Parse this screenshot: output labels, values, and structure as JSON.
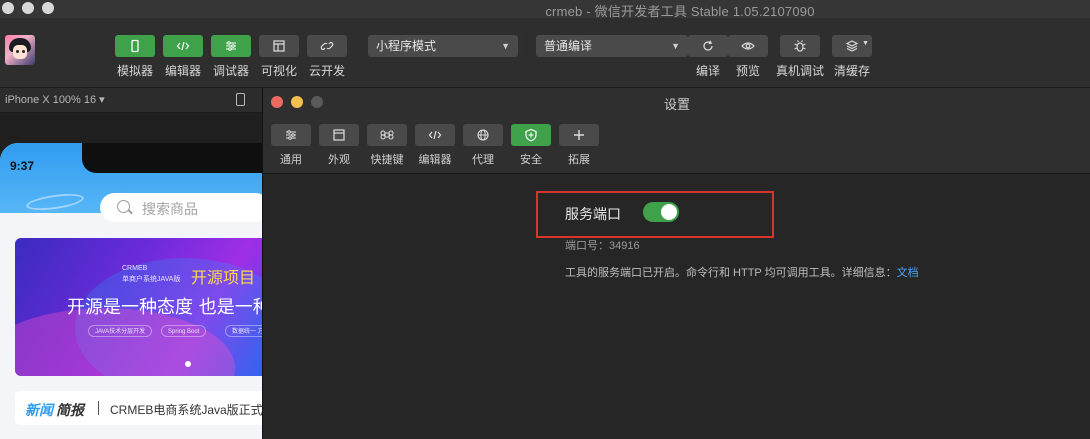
{
  "window": {
    "title": "crmeb - 微信开发者工具 Stable 1.05.2107090"
  },
  "toolbar": {
    "left_buttons": [
      {
        "label": "模拟器",
        "icon": "phone-icon"
      },
      {
        "label": "编辑器",
        "icon": "code-icon"
      },
      {
        "label": "调试器",
        "icon": "sliders-icon"
      },
      {
        "label": "可视化",
        "icon": "layout-icon"
      },
      {
        "label": "云开发",
        "icon": "cloud-link-icon"
      }
    ],
    "mode_select": "小程序模式",
    "compile_select": "普通编译",
    "right_buttons": [
      {
        "label": "编译",
        "icon": "refresh-icon"
      },
      {
        "label": "预览",
        "icon": "eye-icon"
      },
      {
        "label": "真机调试",
        "icon": "bug-icon"
      },
      {
        "label": "清缓存",
        "icon": "layers-icon"
      }
    ]
  },
  "simulator": {
    "device": "iPhone X 100% 16 ▾",
    "time": "9:37",
    "search_placeholder": "搜索商品",
    "banner": {
      "small1": "CRMEB",
      "small2": "单商户系统JAVA版",
      "tag": "开源项目",
      "headline": "开源是一种态度 也是一种",
      "pills": [
        "JAVA技术分层开发",
        "Spring Boot",
        "数据统一 方"
      ]
    },
    "news": {
      "label_a": "新闻",
      "label_b": "简报",
      "text": "CRMEB电商系统Java版正式发布"
    }
  },
  "settings": {
    "title": "设置",
    "tabs": [
      {
        "label": "通用",
        "icon": "sliders-icon"
      },
      {
        "label": "外观",
        "icon": "window-icon"
      },
      {
        "label": "快捷键",
        "icon": "command-icon"
      },
      {
        "label": "编辑器",
        "icon": "code-icon"
      },
      {
        "label": "代理",
        "icon": "globe-icon"
      },
      {
        "label": "安全",
        "icon": "shield-icon"
      },
      {
        "label": "拓展",
        "icon": "plus-icon"
      }
    ],
    "active_tab": "安全",
    "service_port": {
      "label": "服务端口",
      "enabled": true,
      "port_text": "端口号：34916",
      "info_text": "工具的服务端口已开启。命令行和 HTTP 均可调用工具。详细信息：",
      "link_text": "文档"
    }
  },
  "colors": {
    "accent_green": "#3fa14a",
    "highlight_red": "#d6352c",
    "link_blue": "#4da3ff"
  }
}
